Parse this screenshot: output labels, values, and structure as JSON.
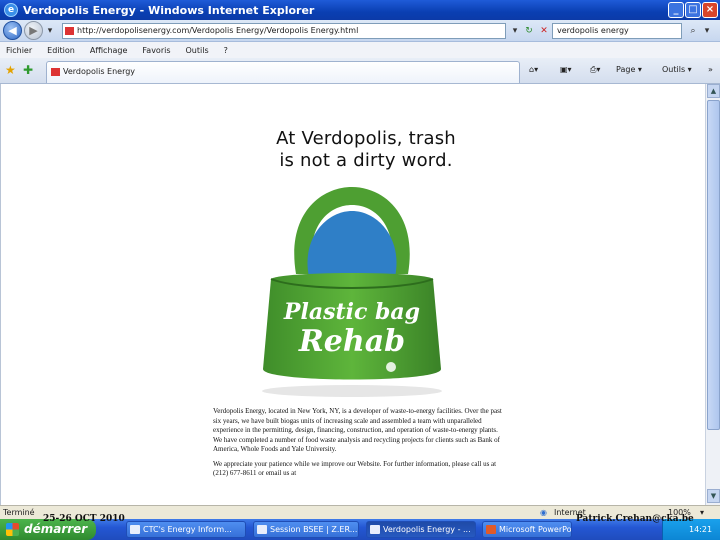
{
  "window": {
    "title": "Verdopolis Energy - Windows Internet Explorer",
    "controls": [
      "_",
      "□",
      "×"
    ]
  },
  "address_bar": {
    "url": "http://verdopolisenergy.com/Verdopolis Energy/Verdopolis Energy.html",
    "search_value": "verdopolis energy"
  },
  "menu": {
    "items": [
      "Fichier",
      "Edition",
      "Affichage",
      "Favoris",
      "Outils",
      "?"
    ]
  },
  "tabs": {
    "active_label": "Verdopolis Energy",
    "page_label": "Page",
    "tools_label": "Outils"
  },
  "page": {
    "headline_1": "At Verdopolis, trash",
    "headline_2": "is not a dirty word.",
    "bag_text_1": "Plastic bag",
    "bag_text_2": "Rehab",
    "paragraph_1": "Verdopolis Energy, located in New York, NY, is a developer of waste-to-energy facilities. Over the past six years, we have built biogas units of increasing scale and assembled a team with unparalleled experience in the permitting, design, financing, construction, and operation of waste-to-energy plants. We have completed a number of food waste analysis and recycling projects for clients such as Bank of America, Whole Foods and Yale University.",
    "paragraph_2": "We appreciate your patience while we improve our Website. For further information, please call us at (212) 677-8611 or email us at"
  },
  "status": {
    "left": "Terminé",
    "zone": "Internet",
    "zoom": "100%"
  },
  "taskbar": {
    "start_label": "démarrer",
    "tasks": [
      "CTC's Energy Inform...",
      "Session BSEE | Z.ER...",
      "Verdopolis Energy - ...",
      "Microsoft PowerPoint ..."
    ],
    "clock": "14:21"
  },
  "overlay": {
    "date": "25-26 OCT 2010",
    "email": "Patrick.Crehan@cka.be"
  }
}
